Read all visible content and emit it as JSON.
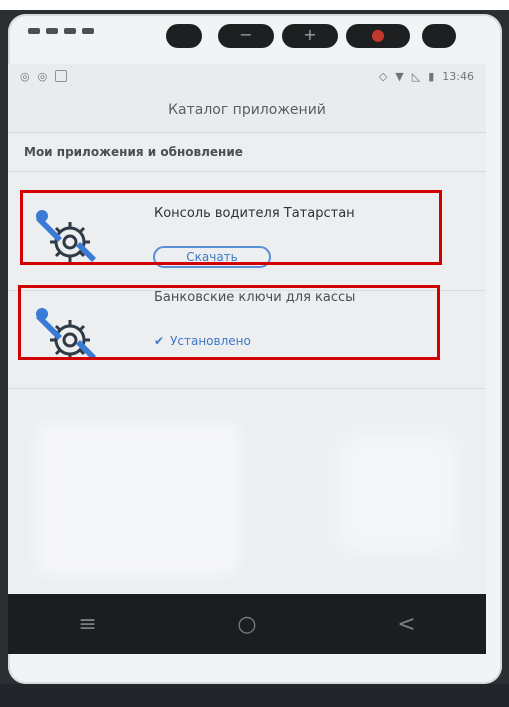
{
  "status_bar": {
    "time": "13:46"
  },
  "header": {
    "title": "Каталог приложений"
  },
  "section": {
    "title": "Мои приложения и обновление"
  },
  "apps": [
    {
      "name": "Консоль водителя Татарстан",
      "action_label": "Скачать",
      "icon": "gear-wrench-icon"
    },
    {
      "name": "Банковские ключи для кассы",
      "status_label": "Установлено",
      "icon": "gear-wrench-icon"
    }
  ],
  "nav": {
    "menu_icon": "≡",
    "home_icon": "○",
    "back_icon": "<"
  },
  "colors": {
    "accent": "#3f79c7",
    "highlight_box": "#d30000"
  }
}
